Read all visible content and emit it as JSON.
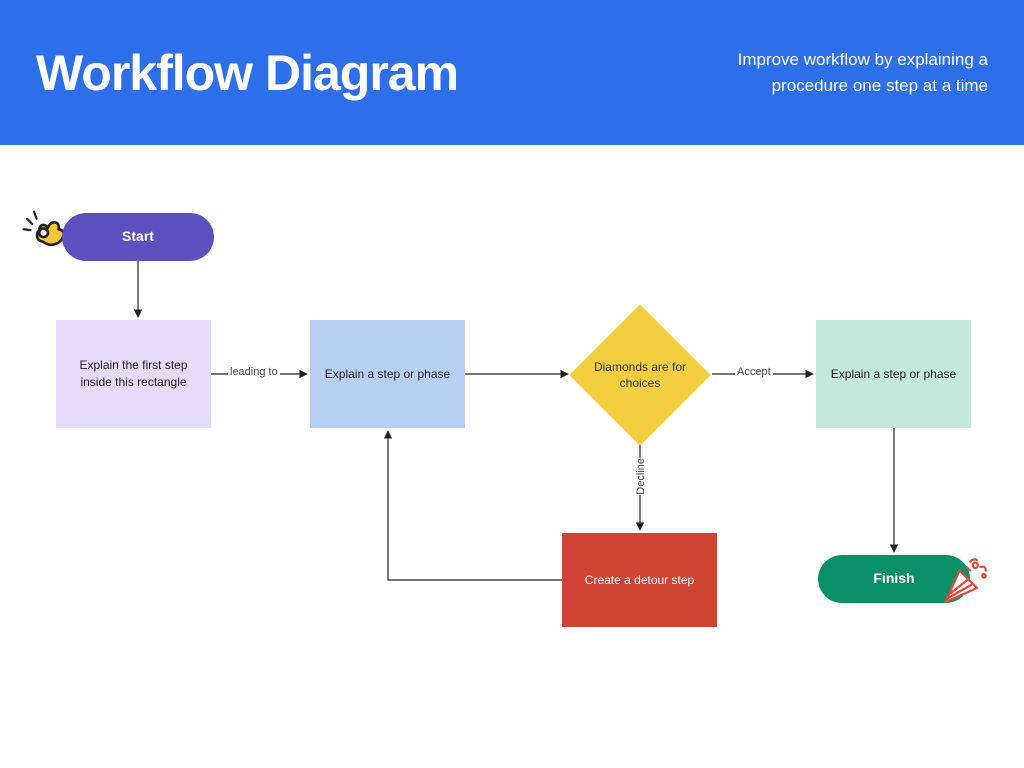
{
  "header": {
    "title": "Workflow Diagram",
    "subtitle": "Improve workflow by explaining a procedure one step at a time"
  },
  "nodes": {
    "start": "Start",
    "finish": "Finish",
    "step1": "Explain the first step inside this rectangle",
    "step2": "Explain a step or phase",
    "decision": "Diamonds are for choices",
    "step3": "Explain a step or phase",
    "detour": "Create a detour step"
  },
  "edges": {
    "leading_to": "leading to",
    "accept": "Accept",
    "decline": "Decline"
  },
  "colors": {
    "header_bg": "#2d6fe8",
    "start": "#5d4fbd",
    "finish": "#0b8f66",
    "step1": "#e3dbf7",
    "step2": "#b8cff2",
    "step3": "#c5e8dc",
    "decision": "#f3cf3f",
    "detour": "#cf4332"
  }
}
